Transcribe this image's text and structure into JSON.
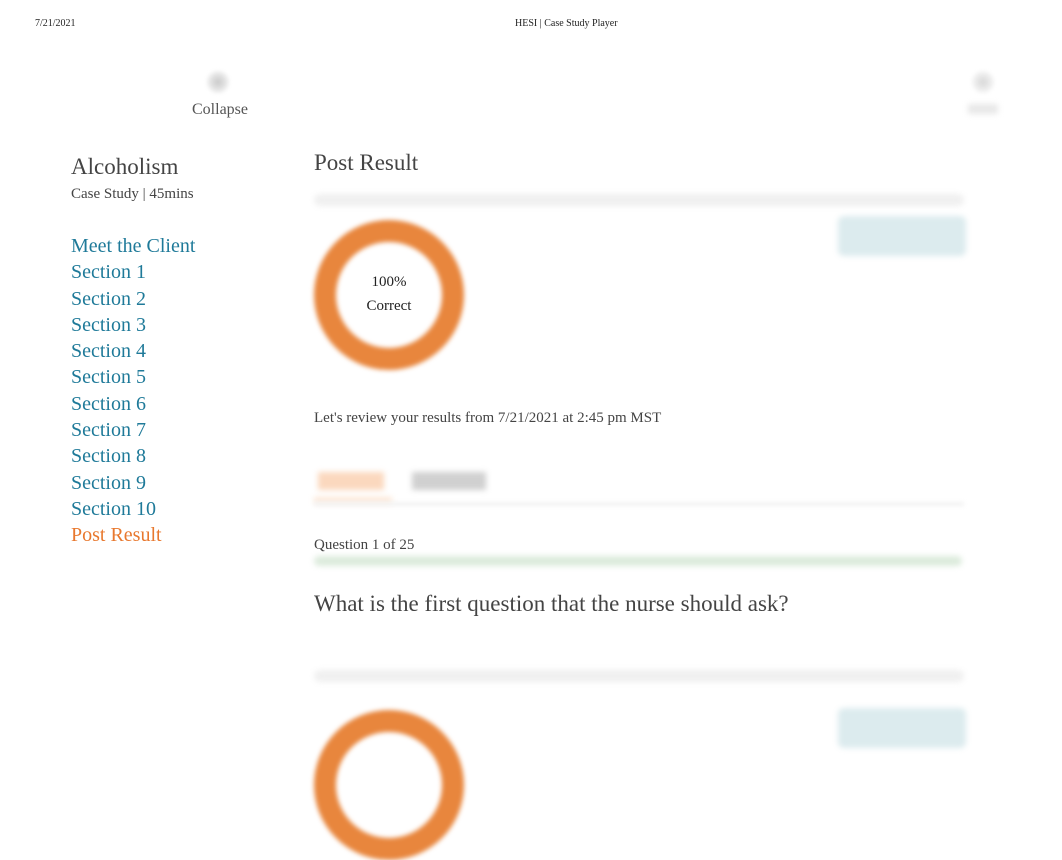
{
  "print_header": {
    "date": "7/21/2021",
    "title": "HESI | Case Study Player"
  },
  "toolbar": {
    "collapse_label": "Collapse",
    "collapse_icon": "collapse-icon",
    "right_icon": "menu-icon"
  },
  "sidebar": {
    "case_title": "Alcoholism",
    "case_meta": "Case Study | 45mins",
    "items": [
      {
        "label": "Meet the Client",
        "active": false
      },
      {
        "label": "Section 1",
        "active": false
      },
      {
        "label": "Section 2",
        "active": false
      },
      {
        "label": "Section 3",
        "active": false
      },
      {
        "label": "Section 4",
        "active": false
      },
      {
        "label": "Section 5",
        "active": false
      },
      {
        "label": "Section 6",
        "active": false
      },
      {
        "label": "Section 7",
        "active": false
      },
      {
        "label": "Section 8",
        "active": false
      },
      {
        "label": "Section 9",
        "active": false
      },
      {
        "label": "Section 10",
        "active": false
      },
      {
        "label": "Post Result",
        "active": true
      }
    ]
  },
  "main": {
    "title": "Post Result",
    "score": {
      "percent_label": "100%",
      "caption": "Correct",
      "percent_value": 100
    },
    "review_text": "Let's review your results from 7/21/2021 at 2:45 pm MST",
    "question": {
      "counter": "Question 1 of 25",
      "current": 1,
      "total": 25,
      "text": "What is the first question that the nurse should ask?"
    }
  },
  "colors": {
    "link": "#1f7a99",
    "active": "#e8782e",
    "ring": "#e8863d",
    "button": "#dcebee"
  }
}
